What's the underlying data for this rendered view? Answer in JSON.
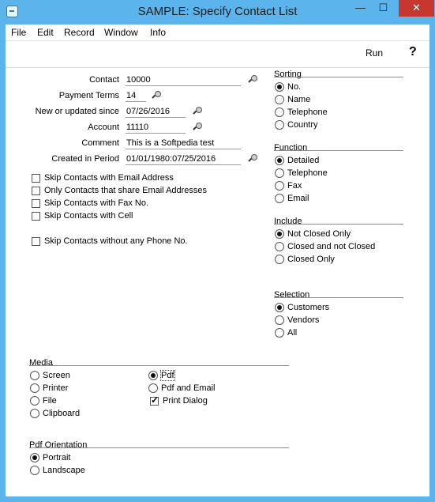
{
  "window": {
    "title": "SAMPLE: Specify Contact List",
    "min_glyph": "—",
    "max_glyph": "☐",
    "close_glyph": "✕"
  },
  "menu": [
    "File",
    "Edit",
    "Record",
    "Window",
    "Info"
  ],
  "toolbar": {
    "run_label": "Run",
    "help_label": "?"
  },
  "fields": {
    "contact": {
      "label": "Contact",
      "value": "10000"
    },
    "payment_terms": {
      "label": "Payment Terms",
      "value": "14"
    },
    "new_updated": {
      "label": "New or updated since",
      "value": "07/26/2016"
    },
    "account": {
      "label": "Account",
      "value": "11110"
    },
    "comment": {
      "label": "Comment",
      "value": "This is a Softpedia test"
    },
    "created_period": {
      "label": "Created in Period",
      "value": "01/01/1980:07/25/2016"
    }
  },
  "checkboxes": [
    {
      "label": "Skip Contacts with Email Address",
      "checked": false
    },
    {
      "label": "Only Contacts that share Email Addresses",
      "checked": false
    },
    {
      "label": "Skip Contacts with Fax No.",
      "checked": false
    },
    {
      "label": "Skip Contacts with Cell",
      "checked": false
    },
    {
      "label": "Skip Contacts without any Phone No.",
      "checked": false
    }
  ],
  "sorting": {
    "title": "Sorting",
    "options": [
      "No.",
      "Name",
      "Telephone",
      "Country"
    ],
    "selected": "No."
  },
  "function": {
    "title": "Function",
    "options": [
      "Detailed",
      "Telephone",
      "Fax",
      "Email"
    ],
    "selected": "Detailed"
  },
  "include": {
    "title": "Include",
    "options": [
      "Not Closed Only",
      "Closed and not Closed",
      "Closed Only"
    ],
    "selected": "Not Closed Only"
  },
  "selection": {
    "title": "Selection",
    "options": [
      "Customers",
      "Vendors",
      "All"
    ],
    "selected": "Customers"
  },
  "media": {
    "title": "Media",
    "left_options": [
      "Screen",
      "Printer",
      "File",
      "Clipboard"
    ],
    "right_options": [
      "Pdf",
      "Pdf and Email"
    ],
    "selected": "Pdf",
    "print_dialog": {
      "label": "Print Dialog",
      "checked": true
    }
  },
  "pdf_orientation": {
    "title": "Pdf Orientation",
    "options": [
      "Portrait",
      "Landscape"
    ],
    "selected": "Portrait"
  }
}
